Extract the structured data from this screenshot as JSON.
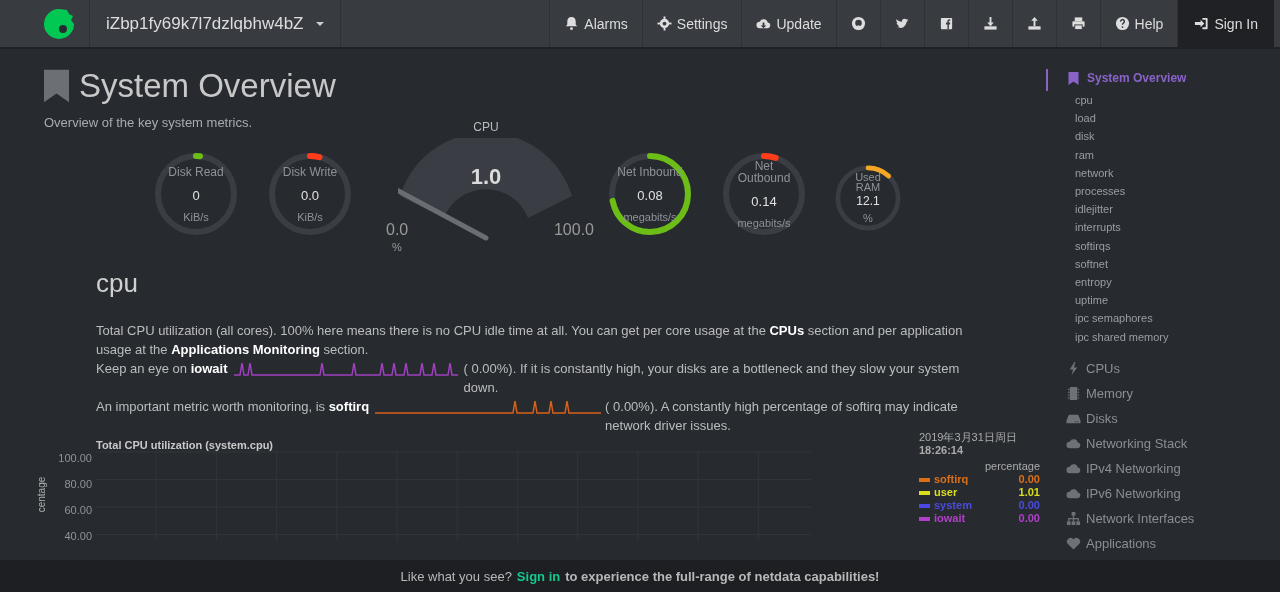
{
  "navbar": {
    "hostname": "iZbp1fy69k7l7dzlqbhw4bZ",
    "buttons": [
      {
        "label": "Alarms",
        "highlighted": false
      },
      {
        "label": "Settings",
        "highlighted": false
      },
      {
        "label": "Update",
        "highlighted": false
      },
      {
        "highlighted": false
      },
      {
        "highlighted": false
      },
      {
        "highlighted": false
      },
      {
        "highlighted": false
      },
      {
        "highlighted": false
      },
      {
        "highlighted": false
      },
      {
        "label": "Help",
        "highlighted": false
      },
      {
        "label": "Sign In",
        "highlighted": true
      }
    ]
  },
  "page": {
    "title": "System Overview",
    "subtitle": "Overview of the key system metrics."
  },
  "gauges": [
    {
      "kind": "pie",
      "title": "Disk Read",
      "value": "0",
      "unit": "KiB/s",
      "level": 0,
      "color": "#6cbd16"
    },
    {
      "kind": "pie",
      "title": "Disk Write",
      "value": "0.0",
      "unit": "KiB/s",
      "level": 0.04,
      "color": "#ff3c1a"
    },
    {
      "kind": "dial",
      "title": "CPU",
      "value": "1.0",
      "min": "0.0",
      "max": "100.0",
      "unit": "%"
    },
    {
      "kind": "pie",
      "title": "Net Inbound",
      "value": "0.08",
      "unit": "megabits/s",
      "level": 0.72,
      "color": "#6cbd16"
    },
    {
      "kind": "pie",
      "title": "Net Outbound",
      "value": "0.14",
      "unit": "megabits/s",
      "level": 0.05,
      "color": "#ff3c1a"
    },
    {
      "kind": "small-pie",
      "title": "Used RAM",
      "value": "12.1",
      "unit": "%",
      "level": 0.12,
      "color": "#f5a623"
    }
  ],
  "section": {
    "heading": "cpu",
    "intro": "Total CPU utilization (all cores). 100% here means there is no CPU idle time at all. You can get per core usage at the **CPUs** section and per application usage at the **Applications Monitoring** section.",
    "watch_lines": [
      {
        "before": "Keep an eye on **iowait**",
        "reading": "(      0.00%). If it is constantly high, your disks are a bottleneck and they slow your system down.",
        "color": "#a040c0"
      },
      {
        "before": "An important metric worth monitoring, is **softirq**",
        "reading": "(      0.00%). A constantly high percentage of softirq may indicate network driver issues.",
        "color": "#d86018"
      }
    ]
  },
  "chart": {
    "title": "Total CPU utilization (system.cpu)",
    "ylabel": "centage",
    "y_ticks": [
      "100.00",
      "80.00",
      "60.00",
      "40.00"
    ],
    "date": "2019年3月31日周日",
    "time": "18:26:14",
    "units": "percentage",
    "legend": [
      {
        "name": "softirq",
        "value": "0.00",
        "color": "#dc7018"
      },
      {
        "name": "user",
        "value": "1.01",
        "color": "#dcdc1e"
      },
      {
        "name": "system",
        "value": "0.00",
        "color": "#4a4ae0"
      },
      {
        "name": "iowait",
        "value": "0.00",
        "color": "#b040c8"
      }
    ]
  },
  "sidebar": {
    "title": "System Overview",
    "items": [
      "cpu",
      "load",
      "disk",
      "ram",
      "network",
      "processes",
      "idlejitter",
      "interrupts",
      "softirqs",
      "softnet",
      "entropy",
      "uptime",
      "ipc semaphores",
      "ipc shared memory"
    ],
    "sections": [
      {
        "label": "CPUs"
      },
      {
        "label": "Memory"
      },
      {
        "label": "Disks"
      },
      {
        "label": "Networking Stack"
      },
      {
        "label": "IPv4 Networking"
      },
      {
        "label": "IPv6 Networking"
      },
      {
        "label": "Network Interfaces"
      },
      {
        "label": "Applications"
      }
    ]
  },
  "footer": {
    "before": "Like what you see?",
    "link": "Sign in",
    "after": "to experience the full-range of netdata capabilities!"
  }
}
